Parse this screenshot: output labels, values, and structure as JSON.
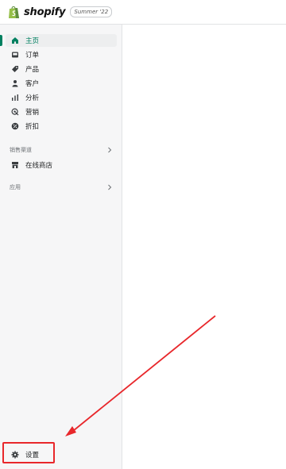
{
  "header": {
    "logo_text": "shopify",
    "version_badge": "Summer '22"
  },
  "sidebar": {
    "items": [
      {
        "label": "主页",
        "icon": "home-icon",
        "active": true
      },
      {
        "label": "订单",
        "icon": "orders-inbox-icon",
        "active": false
      },
      {
        "label": "产品",
        "icon": "tag-icon",
        "active": false
      },
      {
        "label": "客户",
        "icon": "person-icon",
        "active": false
      },
      {
        "label": "分析",
        "icon": "bar-chart-icon",
        "active": false
      },
      {
        "label": "营销",
        "icon": "target-icon",
        "active": false
      },
      {
        "label": "折扣",
        "icon": "discount-icon",
        "active": false
      }
    ],
    "sales_channels": {
      "label": "销售渠道",
      "items": [
        {
          "label": "在线商店",
          "icon": "storefront-icon"
        }
      ]
    },
    "apps": {
      "label": "应用"
    },
    "settings": {
      "label": "设置",
      "icon": "gear-icon"
    }
  },
  "colors": {
    "accent": "#008060",
    "annotation": "#e8272b",
    "sidebar_bg": "#f6f6f7"
  }
}
